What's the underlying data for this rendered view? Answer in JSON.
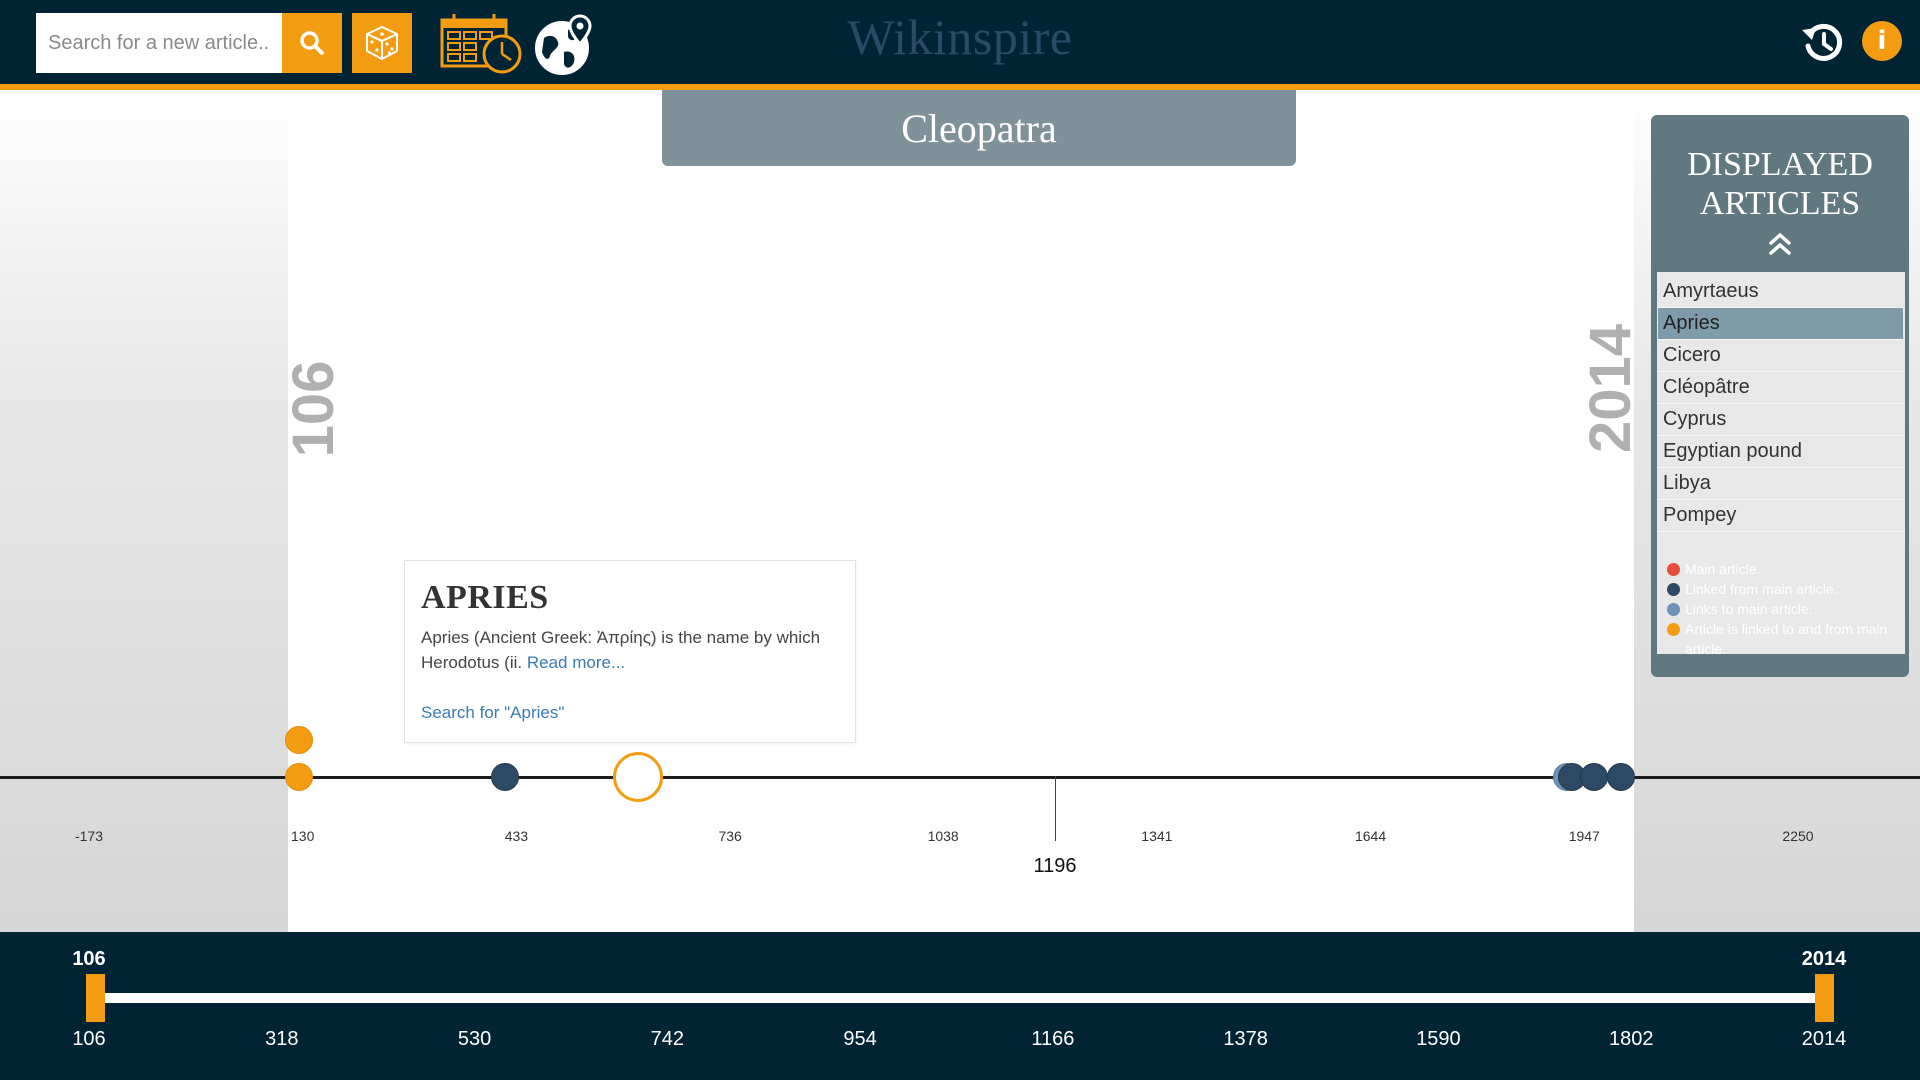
{
  "header": {
    "search_placeholder": "Search for a new article...",
    "site_title": "Wikinspire",
    "info_label": "i",
    "icons": {
      "search": "search-icon",
      "random": "dice-icon",
      "timeline_view": "calendar-clock-icon",
      "map_view": "globe-pin-icon",
      "history": "history-icon",
      "info": "info-icon"
    },
    "accent_color": "#f39c12",
    "background_color": "#012435"
  },
  "main_article": {
    "title": "Cleopatra"
  },
  "range": {
    "start": "106",
    "end": "2014"
  },
  "timeline": {
    "center_year": "1196",
    "tick_labels": [
      "-173",
      "130",
      "433",
      "736",
      "1038",
      "1341",
      "1644",
      "1947",
      "2250"
    ],
    "tick_values": [
      -173,
      130,
      433,
      736,
      1038,
      1341,
      1644,
      1947,
      2250
    ],
    "events": [
      {
        "year": 125,
        "type": "both",
        "stack": 0
      },
      {
        "year": 125,
        "type": "both",
        "stack": 1
      },
      {
        "year": 417,
        "type": "linked-from",
        "stack": 0
      },
      {
        "year": 606,
        "type": "selected",
        "stack": 0
      },
      {
        "year": 1923,
        "type": "links-to",
        "stack": 0
      },
      {
        "year": 1930,
        "type": "linked-from",
        "stack": 0
      },
      {
        "year": 1961,
        "type": "linked-from",
        "stack": 0
      },
      {
        "year": 1999,
        "type": "linked-from",
        "stack": 0
      }
    ]
  },
  "article_card": {
    "title": "APRIES",
    "excerpt": "Apries (Ancient Greek: Ἀπρίης) is the name by which Herodotus (ii.",
    "read_more": "Read more...",
    "search_link": "Search for \"Apries\""
  },
  "displayed_articles": {
    "title": "DISPLAYED ARTICLES",
    "collapse_icon": "double-chevron-up-icon",
    "items": [
      {
        "label": "Amyrtaeus",
        "active": false
      },
      {
        "label": "Apries",
        "active": true
      },
      {
        "label": "Cicero",
        "active": false
      },
      {
        "label": "Cléopâtre",
        "active": false
      },
      {
        "label": "Cyprus",
        "active": false
      },
      {
        "label": "Egyptian pound",
        "active": false
      },
      {
        "label": "Libya",
        "active": false
      },
      {
        "label": "Pompey",
        "active": false
      }
    ],
    "legend": [
      {
        "label": "Main article.",
        "color": "#e74c3c"
      },
      {
        "label": "Linked from main article.",
        "color": "#2c4a63"
      },
      {
        "label": "Links to main article.",
        "color": "#6c93b4"
      },
      {
        "label": "Article is linked to and from main article.",
        "color": "#f39c12"
      }
    ]
  },
  "range_slider": {
    "min_value": "106",
    "max_value": "2014",
    "tick_labels": [
      "106",
      "318",
      "530",
      "742",
      "954",
      "1166",
      "1378",
      "1590",
      "1802",
      "2014"
    ]
  }
}
